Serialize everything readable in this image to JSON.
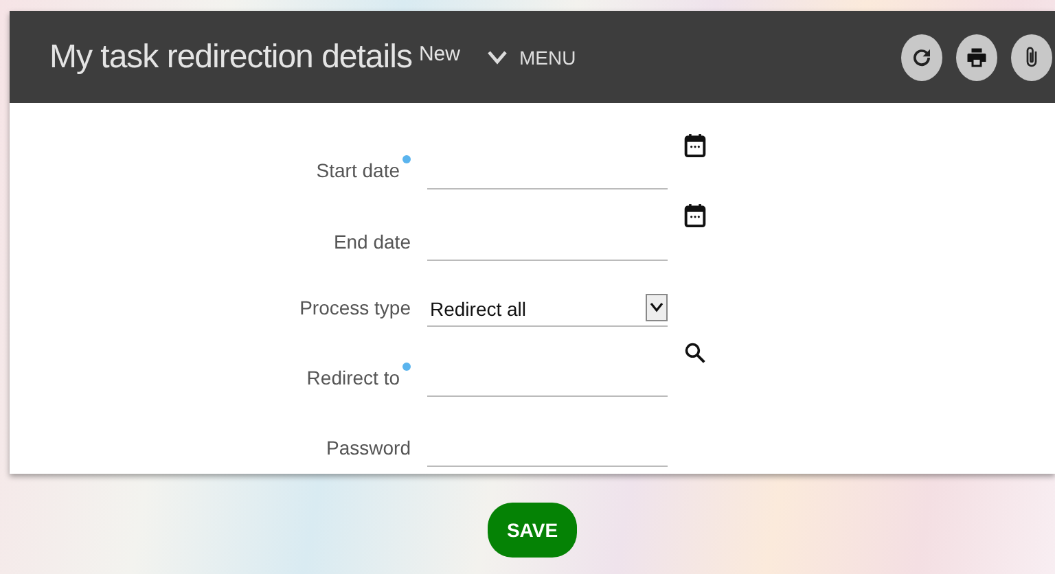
{
  "header": {
    "title": "My task redirection details",
    "badge": "New",
    "menu": "MENU"
  },
  "fields": [
    {
      "label": "Start date",
      "kind": "date",
      "required": true
    },
    {
      "label": "End date",
      "kind": "date",
      "required": false
    },
    {
      "label": "Process type",
      "kind": "select",
      "required": false,
      "value": "Redirect all"
    },
    {
      "label": "Redirect to",
      "kind": "lookup",
      "required": true
    },
    {
      "label": "Password",
      "kind": "password",
      "required": false
    }
  ],
  "save": "SAVE"
}
